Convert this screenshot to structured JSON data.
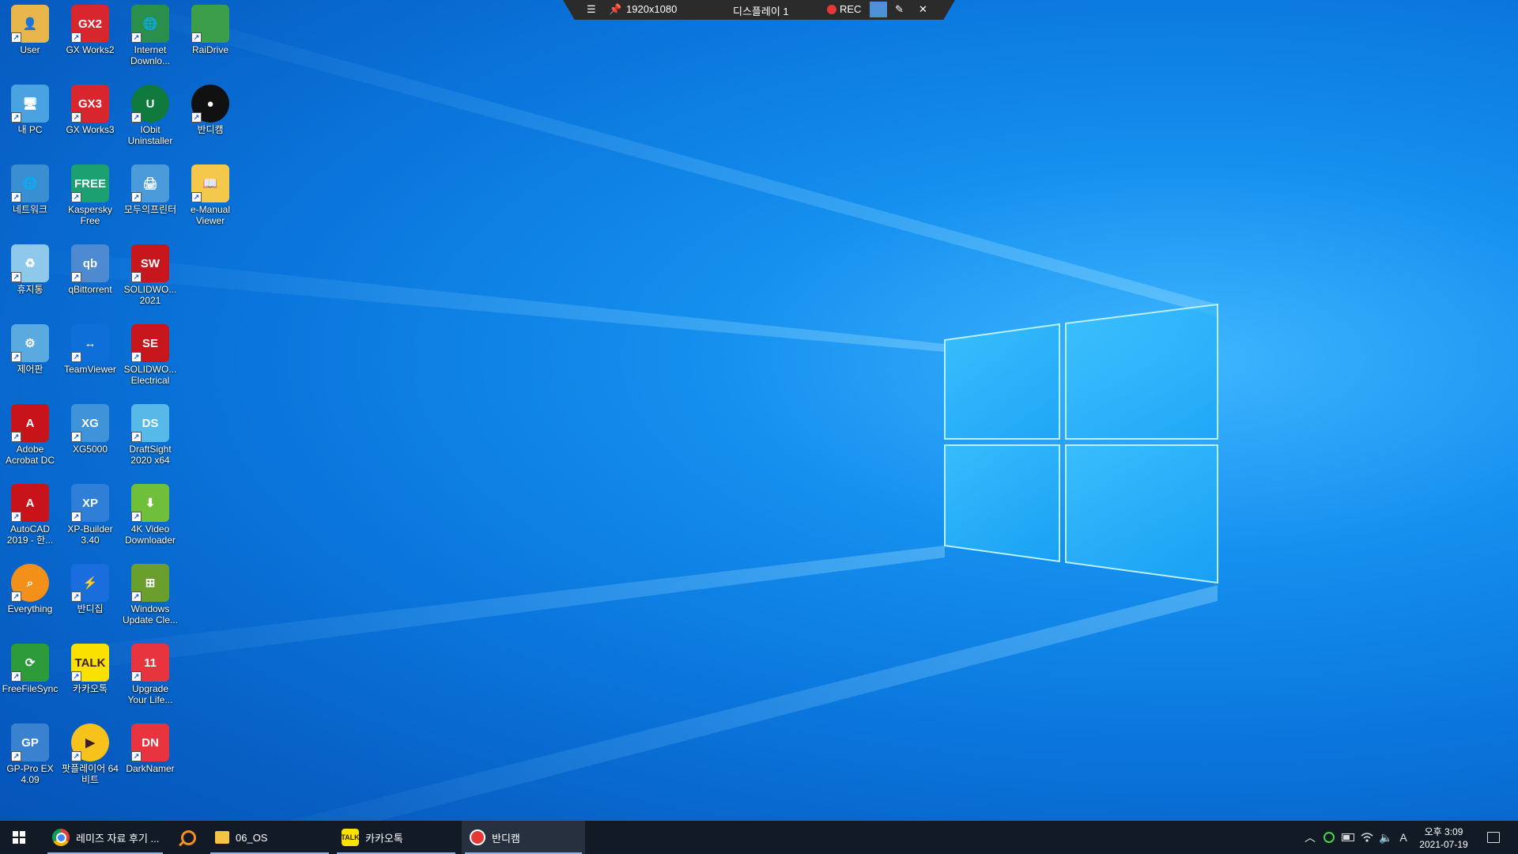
{
  "recorder_toolbar": {
    "menu_icon": "menu-icon",
    "pin_icon": "pin-icon",
    "resolution": "1920x1080",
    "display": "디스플레이 1",
    "rec_label": "REC",
    "rec_color": "#e53935",
    "draw_icon": "pencil-icon",
    "close_icon": "close-icon"
  },
  "desktop_icons": [
    {
      "label": "User",
      "icon": "user-folder-icon"
    },
    {
      "label": "GX Works2",
      "icon": "gx-works2-icon"
    },
    {
      "label": "Internet Downlo...",
      "icon": "internet-download-manager-icon"
    },
    {
      "label": "RaiDrive",
      "icon": "raidrive-icon"
    },
    {
      "label": "내 PC",
      "icon": "this-pc-icon"
    },
    {
      "label": "GX Works3",
      "icon": "gx-works3-icon"
    },
    {
      "label": "IObit Uninstaller",
      "icon": "iobit-uninstaller-icon"
    },
    {
      "label": "반디캠",
      "icon": "bandicam-icon"
    },
    {
      "label": "네트워크",
      "icon": "network-icon"
    },
    {
      "label": "Kaspersky Free",
      "icon": "kaspersky-icon"
    },
    {
      "label": "모두의프린터",
      "icon": "printer-icon"
    },
    {
      "label": "e-Manual Viewer",
      "icon": "e-manual-viewer-icon"
    },
    {
      "label": "휴지통",
      "icon": "recycle-bin-icon"
    },
    {
      "label": "qBittorrent",
      "icon": "qbittorrent-icon"
    },
    {
      "label": "SOLIDWO... 2021",
      "icon": "solidworks-icon"
    },
    {
      "label": "제어판",
      "icon": "control-panel-icon"
    },
    {
      "label": "TeamViewer",
      "icon": "teamviewer-icon"
    },
    {
      "label": "SOLIDWO... Electrical",
      "icon": "solidworks-electrical-icon"
    },
    {
      "label": "Adobe Acrobat DC",
      "icon": "acrobat-icon"
    },
    {
      "label": "XG5000",
      "icon": "xg5000-icon"
    },
    {
      "label": "DraftSight 2020 x64",
      "icon": "draftsight-icon"
    },
    {
      "label": "AutoCAD 2019 - 한...",
      "icon": "autocad-icon"
    },
    {
      "label": "XP-Builder 3.40",
      "icon": "xp-builder-icon"
    },
    {
      "label": "4K Video Downloader",
      "icon": "4k-video-downloader-icon"
    },
    {
      "label": "Everything",
      "icon": "everything-search-icon"
    },
    {
      "label": "반디집",
      "icon": "bandizip-icon"
    },
    {
      "label": "Windows Update Cle...",
      "icon": "windows-update-cleaner-icon"
    },
    {
      "label": "FreeFileSync",
      "icon": "freefilesync-icon"
    },
    {
      "label": "카카오톡",
      "icon": "kakaotalk-icon"
    },
    {
      "label": "Upgrade Your Life...",
      "icon": "11st-icon"
    },
    {
      "label": "GP-Pro EX 4.09",
      "icon": "gp-pro-ex-icon"
    },
    {
      "label": "팟플레이어 64 비트",
      "icon": "potplayer-icon"
    },
    {
      "label": "DarkNamer",
      "icon": "darknamer-icon"
    }
  ],
  "taskbar": {
    "start_icon": "windows-start-icon",
    "apps": [
      {
        "label": "레미즈 자료 후기 ...",
        "icon": "chrome-icon"
      },
      {
        "label": "",
        "icon": "everything-search-icon"
      },
      {
        "label": "06_OS",
        "icon": "folder-icon"
      },
      {
        "label": "카카오톡",
        "icon": "kakaotalk-icon"
      },
      {
        "label": "반디캠",
        "icon": "bandicam-icon"
      }
    ],
    "tray": {
      "chevron_icon": "chevron-up-icon",
      "ime": "A",
      "time": "오후 3:09",
      "date": "2021-07-19"
    }
  }
}
